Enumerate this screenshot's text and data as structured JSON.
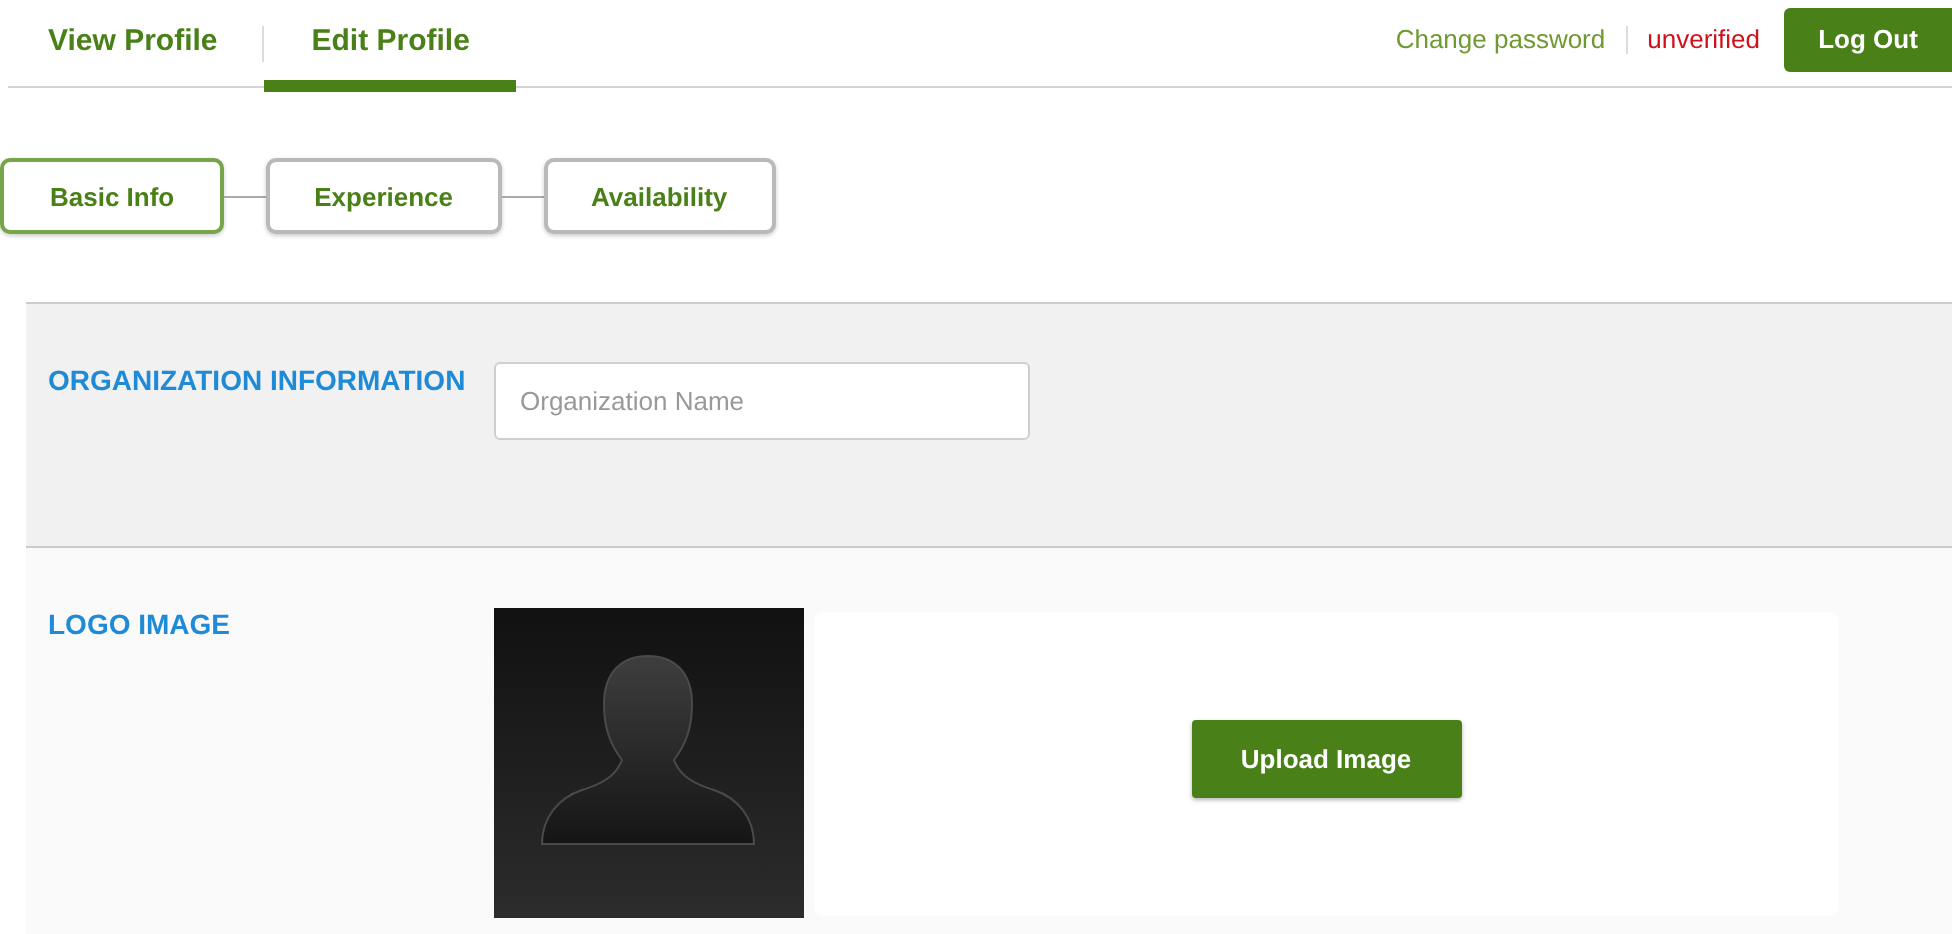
{
  "tabs": [
    {
      "label": "View Profile",
      "selected": false
    },
    {
      "label": "Edit Profile",
      "selected": true
    }
  ],
  "account": {
    "change_password": "Change password",
    "status": "unverified",
    "logout": "Log Out"
  },
  "steps": [
    {
      "label": "Basic Info",
      "selected": true
    },
    {
      "label": "Experience",
      "selected": false
    },
    {
      "label": "Availability",
      "selected": false
    }
  ],
  "sections": [
    {
      "kind": "field",
      "title": "ORGANIZATION INFORMATION",
      "placeholder": "Organization Name"
    },
    {
      "kind": "image",
      "title": "LOGO IMAGE",
      "button": "Upload Image"
    }
  ]
}
